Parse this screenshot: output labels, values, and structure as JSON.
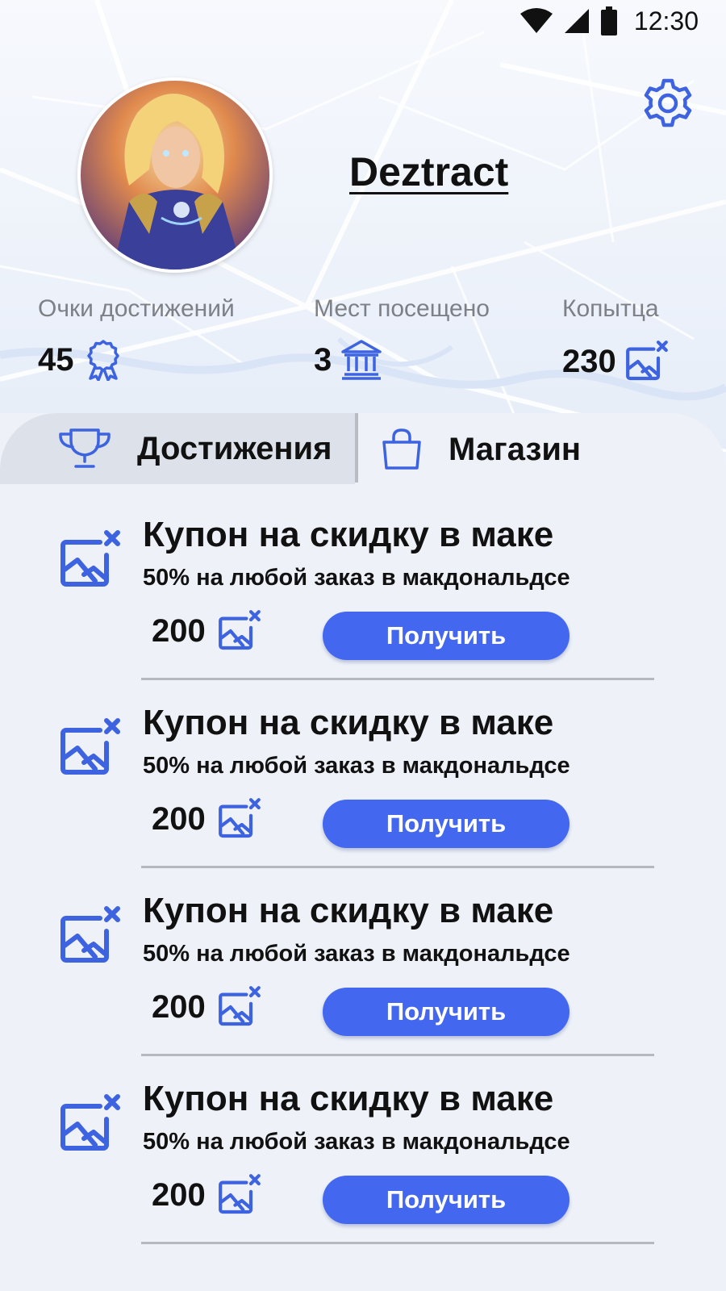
{
  "status_bar": {
    "time": "12:30"
  },
  "profile": {
    "username": "Deztract",
    "stats": [
      {
        "label": "Очки достижений",
        "value": "45",
        "icon": "award-ribbon-icon"
      },
      {
        "label": "Мест посещено",
        "value": "3",
        "icon": "museum-icon"
      },
      {
        "label": "Копытца",
        "value": "230",
        "icon": "image-placeholder-icon"
      }
    ]
  },
  "tabs": [
    {
      "label": "Достижения",
      "icon": "trophy-icon"
    },
    {
      "label": "Магазин",
      "icon": "shopping-bag-icon"
    }
  ],
  "coupons": [
    {
      "title": "Купон на скидку в маке",
      "description": "50% на любой заказ в макдональдсе",
      "price": "200",
      "button": "Получить"
    },
    {
      "title": "Купон на скидку в маке",
      "description": "50% на любой заказ в макдональдсе",
      "price": "200",
      "button": "Получить"
    },
    {
      "title": "Купон на скидку в маке",
      "description": "50% на любой заказ в макдональдсе",
      "price": "200",
      "button": "Получить"
    },
    {
      "title": "Купон на скидку в маке",
      "description": "50% на любой заказ в макдональдсе",
      "price": "200",
      "button": "Получить"
    }
  ],
  "colors": {
    "accent": "#4467f0",
    "icon": "#3d63e0",
    "text": "#111111",
    "muted": "#7d8087"
  }
}
